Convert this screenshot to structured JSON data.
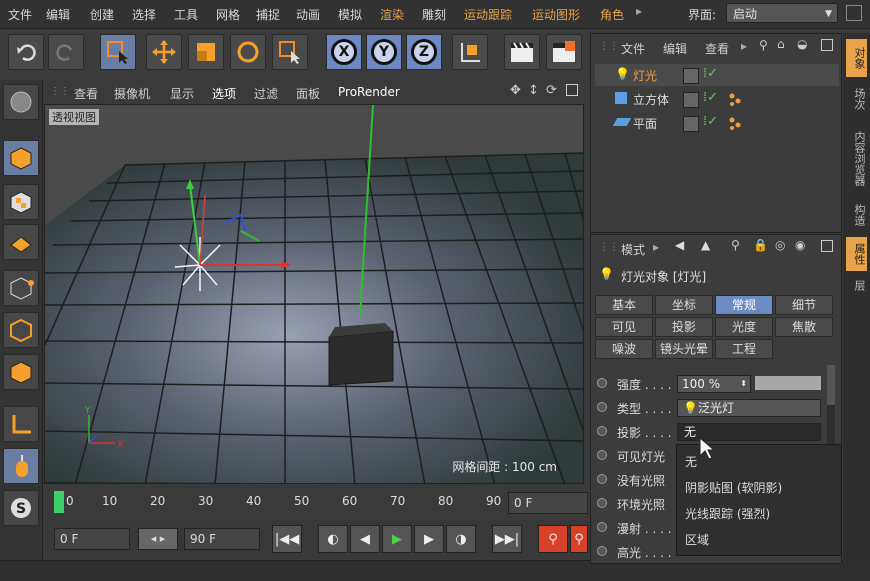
{
  "menubar": {
    "items": [
      "文件",
      "编辑",
      "创建",
      "选择",
      "工具",
      "网格",
      "捕捉",
      "动画",
      "模拟",
      "渲染",
      "雕刻",
      "运动跟踪",
      "运动图形",
      "角色"
    ],
    "layout_label": "界面:",
    "layout_value": "启动"
  },
  "viewport": {
    "menu": [
      "查看",
      "摄像机",
      "显示",
      "选项",
      "过滤",
      "面板",
      "ProRender"
    ],
    "label": "透视视图",
    "grid_info": "网格间距 : 100 cm"
  },
  "timeline": {
    "ticks": [
      "0",
      "10",
      "20",
      "30",
      "40",
      "50",
      "60",
      "70",
      "80",
      "90"
    ],
    "current_frame": "0 F"
  },
  "playback": {
    "start_frame": "0 F",
    "end_frame": "90 F"
  },
  "object_manager": {
    "menu": [
      "文件",
      "编辑",
      "查看"
    ],
    "objects": [
      {
        "name": "灯光",
        "selected": true
      },
      {
        "name": "立方体",
        "selected": false
      },
      {
        "name": "平面",
        "selected": false
      }
    ]
  },
  "side_tabs": [
    "对象",
    "场次",
    "内容浏览器",
    "构造",
    "属性",
    "层"
  ],
  "attributes": {
    "mode_label": "模式",
    "title": "灯光对象 [灯光]",
    "tabs": [
      "基本",
      "坐标",
      "常规",
      "细节",
      "可见",
      "投影",
      "光度",
      "焦散",
      "噪波",
      "镜头光晕",
      "工程"
    ],
    "active_tab": "常规",
    "props": {
      "intensity_label": "强度 . . . .",
      "intensity_value": "100 %",
      "type_label": "类型 . . . .",
      "type_value": "泛光灯",
      "shadow_label": "投影 . . . .",
      "shadow_value": "无",
      "visible_light_label": "可见灯光",
      "no_light_label": "没有光照",
      "ambient_label": "环境光照",
      "diffuse_label": "漫射 . . . .",
      "specular_label": "高光 . . . ."
    }
  },
  "dropdown": {
    "options": [
      "无",
      "阴影贴图 (软阴影)",
      "光线跟踪 (强烈)",
      "区域"
    ]
  }
}
